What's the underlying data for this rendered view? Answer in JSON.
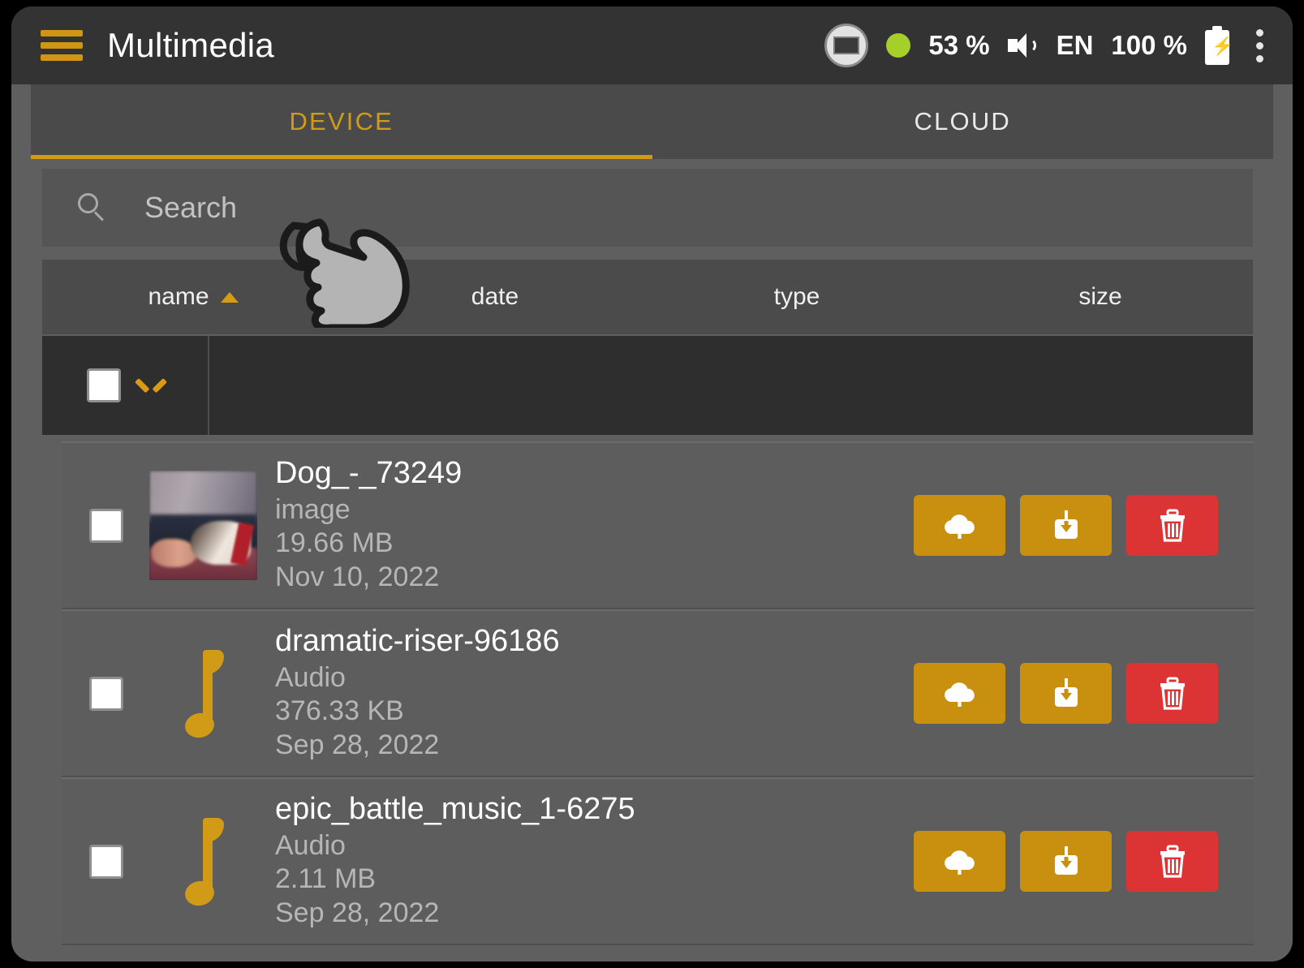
{
  "appbar": {
    "menu_icon": "hamburger-icon",
    "title": "Multimedia",
    "status": {
      "screen_icon": "screen-icon",
      "indicator_icon": "green-dot-icon",
      "signal_percent": "53 %",
      "volume_icon": "speaker-icon",
      "language": "EN",
      "battery_percent": "100 %",
      "battery_icon": "battery-charging-icon",
      "overflow_icon": "more-vertical-icon"
    }
  },
  "tabs": [
    {
      "label": "DEVICE",
      "active": true
    },
    {
      "label": "CLOUD",
      "active": false
    }
  ],
  "search": {
    "icon": "search-icon",
    "placeholder": "Search",
    "value": ""
  },
  "columns": [
    {
      "label": "name",
      "sorted": true,
      "sort_direction": "asc"
    },
    {
      "label": "date",
      "sorted": false
    },
    {
      "label": "type",
      "sorted": false
    },
    {
      "label": "size",
      "sorted": false
    }
  ],
  "select_bar": {
    "select_all_checked": false,
    "dropdown_icon": "chevron-down-icon"
  },
  "files": [
    {
      "name": "Dog_-_73249",
      "type": "image",
      "size": "19.66 MB",
      "date": "Nov 10, 2022",
      "thumbnail": "dog-photo-thumbnail",
      "checked": false,
      "actions": {
        "upload": "cloud-upload-icon",
        "download": "download-icon",
        "delete": "trash-icon"
      }
    },
    {
      "name": "dramatic-riser-96186",
      "type": "Audio",
      "size": "376.33 KB",
      "date": "Sep 28, 2022",
      "thumbnail": "music-note-icon",
      "checked": false,
      "actions": {
        "upload": "cloud-upload-icon",
        "download": "download-icon",
        "delete": "trash-icon"
      }
    },
    {
      "name": "epic_battle_music_1-6275",
      "type": "Audio",
      "size": "2.11 MB",
      "date": "Sep 28, 2022",
      "thumbnail": "music-note-icon",
      "checked": false,
      "actions": {
        "upload": "cloud-upload-icon",
        "download": "download-icon",
        "delete": "trash-icon"
      }
    }
  ],
  "cursor": {
    "icon": "pointing-hand-cursor"
  },
  "colors": {
    "accent": "#d19a17",
    "button_amber": "#c8900e",
    "button_red": "#dc3434",
    "appbar_bg": "#333333",
    "tab_bg": "#4a4a4a",
    "row_bg": "#5d5d5d",
    "select_bar_bg": "#2e2e2e",
    "status_green": "#a5d02a"
  }
}
